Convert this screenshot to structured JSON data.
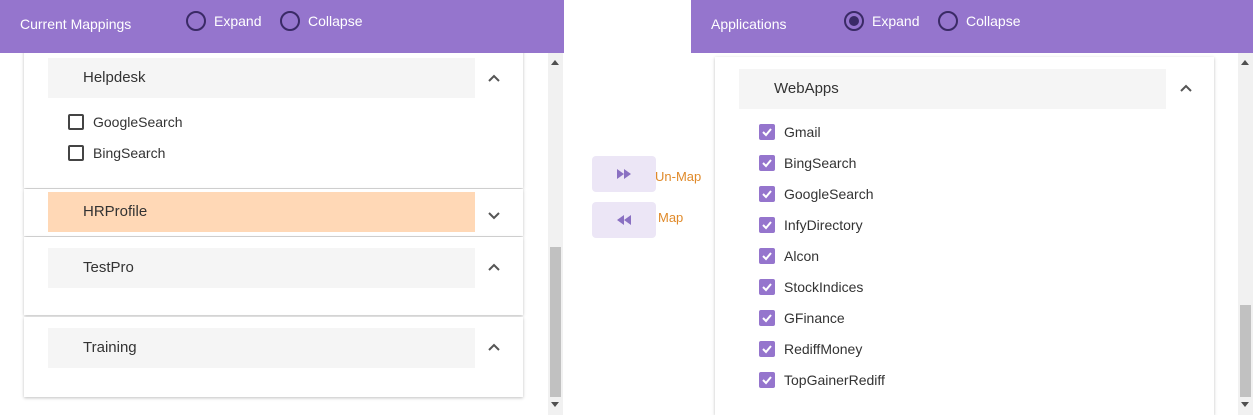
{
  "left_header": {
    "title": "Current Mappings",
    "expand_label": "Expand",
    "collapse_label": "Collapse",
    "selected": "none"
  },
  "right_header": {
    "title": "Applications",
    "expand_label": "Expand",
    "collapse_label": "Collapse",
    "selected": "expand"
  },
  "current_mappings": {
    "groups": [
      {
        "name": "Helpdesk",
        "expanded": true,
        "items": [
          {
            "label": "GoogleSearch",
            "checked": false
          },
          {
            "label": "BingSearch",
            "checked": false
          }
        ]
      },
      {
        "name": "HRProfile",
        "expanded": false,
        "highlighted": true,
        "items": []
      },
      {
        "name": "TestPro",
        "expanded": true,
        "items": []
      },
      {
        "name": "Training",
        "expanded": true,
        "items": []
      }
    ]
  },
  "middle": {
    "unmap_label": "Un-Map",
    "map_label": "Map"
  },
  "applications": {
    "group_name": "WebApps",
    "expanded": true,
    "items": [
      {
        "label": "Gmail",
        "checked": true
      },
      {
        "label": "BingSearch",
        "checked": true
      },
      {
        "label": "GoogleSearch",
        "checked": true
      },
      {
        "label": "InfyDirectory",
        "checked": true
      },
      {
        "label": "Alcon",
        "checked": true
      },
      {
        "label": "StockIndices",
        "checked": true
      },
      {
        "label": "GFinance",
        "checked": true
      },
      {
        "label": "RediffMoney",
        "checked": true
      },
      {
        "label": "TopGainerRediff",
        "checked": true
      }
    ]
  },
  "colors": {
    "header": "#9575cd",
    "highlight": "#ffd8b6",
    "accent_text": "#e08a2a",
    "checkbox_on": "#9575cd"
  }
}
